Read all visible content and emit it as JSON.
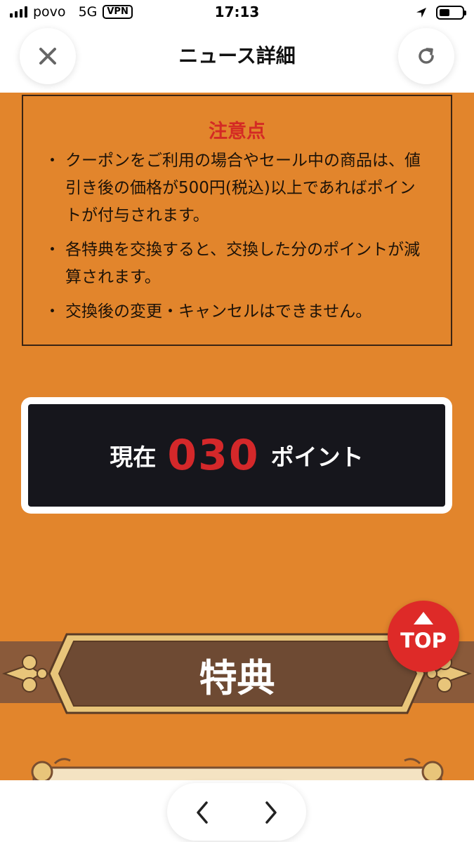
{
  "status_bar": {
    "carrier": "povo",
    "network": "5G",
    "vpn": "VPN",
    "time": "17:13"
  },
  "header": {
    "title": "ニュース詳細",
    "close_icon": "close-icon",
    "reload_icon": "reload-icon"
  },
  "notice": {
    "heading": "注意点",
    "items": [
      "クーポンをご利用の場合やセール中の商品は、値引き後の価格が500円(税込)以上であればポイントが付与されます。",
      "各特典を交換すると、交換した分のポイントが減算されます。",
      "交換後の変更・キャンセルはできません。"
    ]
  },
  "points": {
    "prefix": "現在",
    "value": "030",
    "suffix": "ポイント"
  },
  "section": {
    "title": "特典"
  },
  "top_button": {
    "label": "TOP"
  },
  "toolbar": {
    "back_icon": "chevron-left-icon",
    "forward_icon": "chevron-right-icon"
  },
  "colors": {
    "background_orange": "#E2852C",
    "accent_red": "#D42A24",
    "points_panel": "#16161C",
    "banner_brown": "#6E4A33",
    "banner_gold": "#E8C57A"
  }
}
